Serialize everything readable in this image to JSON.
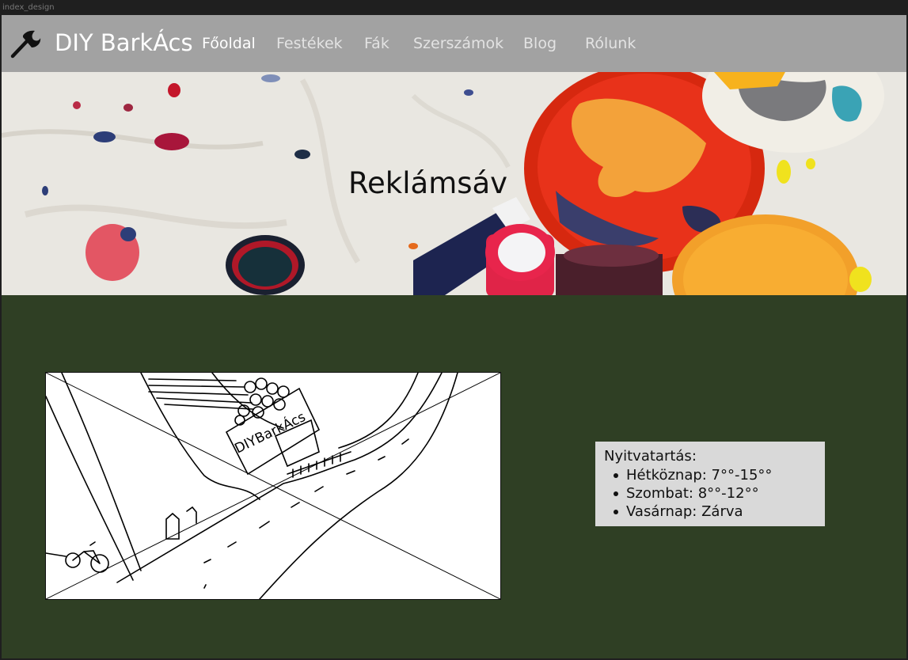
{
  "window": {
    "label": "index_design"
  },
  "navbar": {
    "brand": "DIY BarkÁcs",
    "links": [
      {
        "label": "Főoldal",
        "active": true
      },
      {
        "label": "Festékek",
        "active": false
      },
      {
        "label": "Fák",
        "active": false
      },
      {
        "label": "Szerszámok",
        "active": false
      },
      {
        "label": "Blog",
        "active": false
      },
      {
        "label": "Rólunk",
        "active": false
      }
    ]
  },
  "hero": {
    "title": "Reklámsáv"
  },
  "sketch": {
    "sign_text": "DIYBarkÁcs"
  },
  "hours": {
    "title": "Nyitvatartás:",
    "items": [
      "Hétköznap: 7°°-15°°",
      "Szombat: 8°°-12°°",
      "Vasárnap: Zárva"
    ]
  },
  "colors": {
    "navbar_bg": "#a2a2a2",
    "page_bg": "#2f3f24",
    "hours_bg": "#d9d9d9",
    "text_light": "#ffffff"
  },
  "icons": {
    "logo": "axe-icon"
  }
}
